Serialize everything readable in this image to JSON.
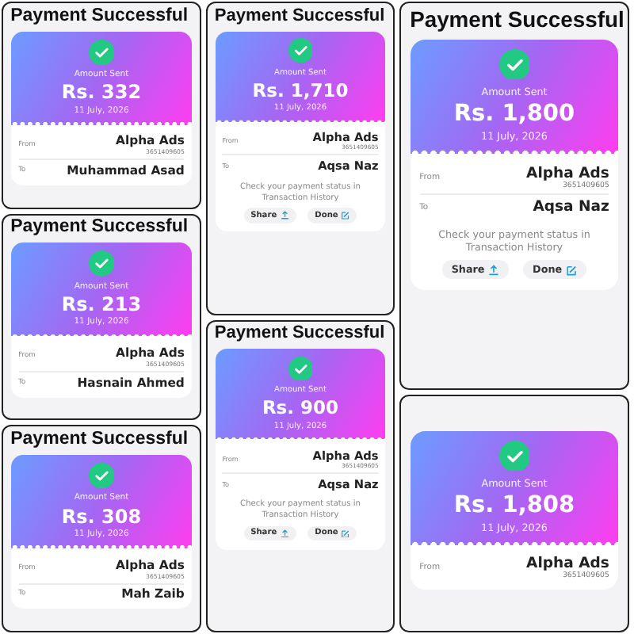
{
  "columns": [
    {
      "panels": [
        {
          "title": "Payment Successful",
          "label": "Amount Sent",
          "amount": "Rs. 332",
          "date": "11 July, 2026",
          "from_label": "From",
          "from_name": "Alpha Ads",
          "from_account": "3651409605",
          "to_label": "To",
          "to_name": "Muhammad Asad"
        },
        {
          "title": "Payment Successful",
          "label": "Amount Sent",
          "amount": "Rs. 213",
          "date": "11 July, 2026",
          "from_label": "From",
          "from_name": "Alpha Ads",
          "from_account": "3651409605",
          "to_label": "To",
          "to_name": "Hasnain Ahmed"
        },
        {
          "title": "Payment Successful",
          "label": "Amount Sent",
          "amount": "Rs. 308",
          "date": "11 July, 2026",
          "from_label": "From",
          "from_name": "Alpha Ads",
          "from_account": "3651409605",
          "to_label": "To",
          "to_name": "Mah Zaib"
        }
      ]
    },
    {
      "panels": [
        {
          "title": "Payment Successful",
          "label": "Amount Sent",
          "amount": "Rs. 1,710",
          "date": "11 July, 2026",
          "from_label": "From",
          "from_name": "Alpha Ads",
          "from_account": "3651409605",
          "to_label": "To",
          "to_name": "Aqsa Naz",
          "note": "Check your payment status in Transaction History",
          "buttons": [
            {
              "label": "Share",
              "kind": "share"
            },
            {
              "label": "Done",
              "kind": "done"
            }
          ]
        },
        {
          "title": "Payment Successful",
          "label": "Amount Sent",
          "amount": "Rs. 900",
          "date": "11 July, 2026",
          "from_label": "From",
          "from_name": "Alpha Ads",
          "from_account": "3651409605",
          "to_label": "To",
          "to_name": "Aqsa Naz",
          "note": "Check your payment status in Transaction History",
          "buttons": [
            {
              "label": "Share",
              "kind": "share"
            },
            {
              "label": "Done",
              "kind": "done"
            }
          ]
        }
      ]
    },
    {
      "panels": [
        {
          "title": "Payment Successful",
          "label": "Amount Sent",
          "amount": "Rs. 1,800",
          "date": "11 July, 2026",
          "from_label": "From",
          "from_name": "Alpha Ads",
          "from_account": "3651409605",
          "to_label": "To",
          "to_name": "Aqsa Naz",
          "note": "Check your payment status in Transaction History",
          "buttons": [
            {
              "label": "Share",
              "kind": "share"
            },
            {
              "label": "Done",
              "kind": "done"
            }
          ]
        },
        {
          "label": "Amount Sent",
          "amount": "Rs. 1,808",
          "date": "11 July, 2026",
          "from_label": "From",
          "from_name": "Alpha Ads",
          "from_account": "3651409605"
        }
      ]
    }
  ]
}
